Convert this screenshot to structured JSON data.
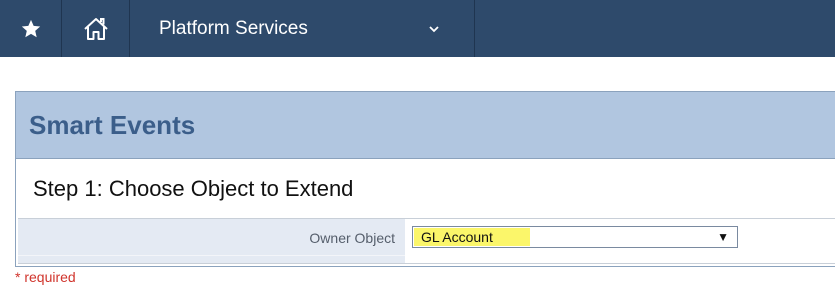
{
  "topbar": {
    "favorites_icon": "star-icon",
    "home_icon": "home-icon",
    "module_label": "Platform Services",
    "dropdown_icon": "chevron-down-icon"
  },
  "panel": {
    "title": "Smart Events",
    "step_title": "Step 1: Choose Object to Extend",
    "field": {
      "label": "Owner Object",
      "selected_value": "GL Account",
      "arrow": "▼"
    }
  },
  "required_note": "* required",
  "colors": {
    "nav_bg": "#2e4a6b",
    "panel_header_bg": "#b1c6e0",
    "title_color": "#3b5e8a",
    "highlight": "#fbf66a",
    "required": "#d0342c"
  }
}
